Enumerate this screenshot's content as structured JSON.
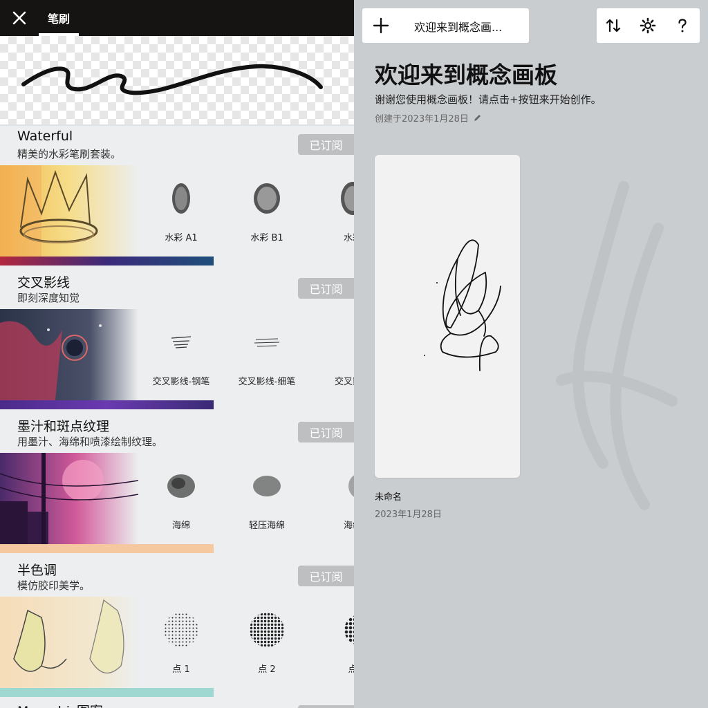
{
  "left": {
    "tab_label": "笔刷",
    "packs": [
      {
        "title": "Waterful",
        "desc": "精美的水彩笔刷套装。",
        "subscribed": "已订阅",
        "brushes": [
          "水彩 A1",
          "水彩 B1",
          "水彩"
        ]
      },
      {
        "title": "交叉影线",
        "desc": "即刻深度知觉",
        "subscribed": "已订阅",
        "brushes": [
          "交叉影线-钢笔",
          "交叉影线-细笔",
          "交叉影线"
        ]
      },
      {
        "title": "墨汁和斑点纹理",
        "desc": "用墨汁、海绵和喷漆绘制纹理。",
        "subscribed": "已订阅",
        "brushes": [
          "海绵",
          "轻压海绵",
          "海绵"
        ]
      },
      {
        "title": "半色调",
        "desc": "模仿胶印美学。",
        "subscribed": "已订阅",
        "brushes": [
          "点 1",
          "点 2",
          "点"
        ]
      }
    ],
    "next_pack_title": "Memphis图案"
  },
  "right": {
    "new_button_label": "欢迎来到概念画...",
    "title": "欢迎来到概念画板",
    "subtitle": "谢谢您使用概念画板！请点击+按钮来开始创作。",
    "created": "创建于2023年1月28日",
    "drawing": {
      "name": "未命名",
      "date": "2023年1月28日"
    }
  }
}
